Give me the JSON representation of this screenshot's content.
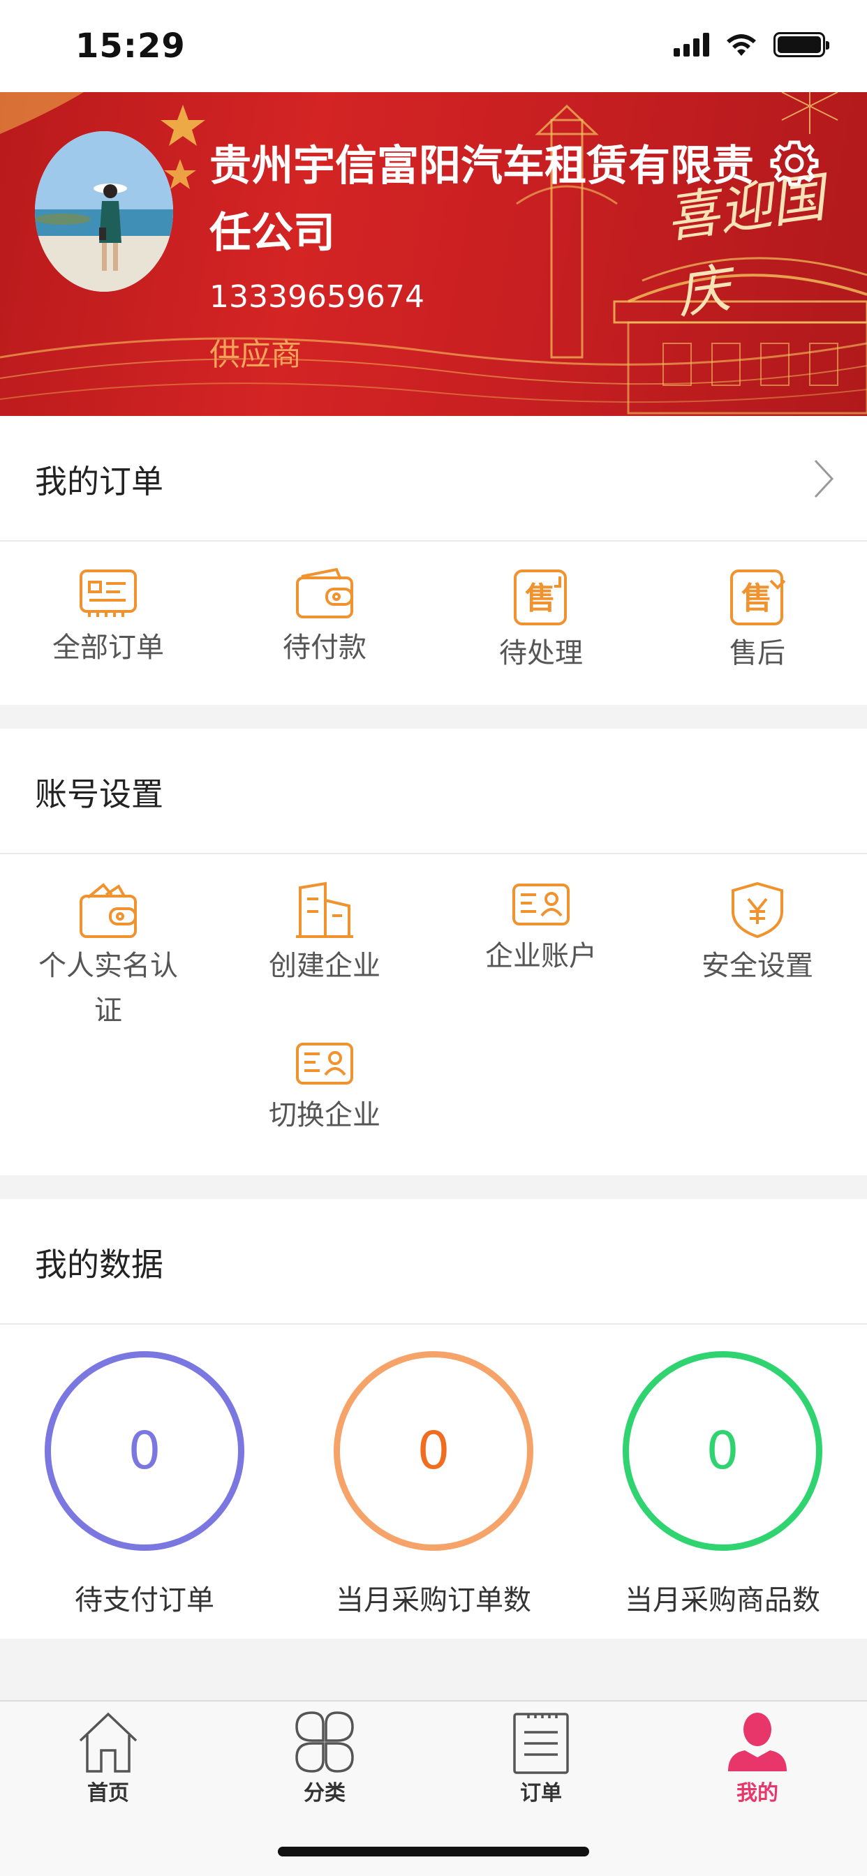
{
  "status_bar": {
    "time": "15:29"
  },
  "profile": {
    "company_name": "贵州宇信富阳汽车租赁有限责任公司",
    "phone": "13339659674",
    "role": "供应商",
    "banner_text": "喜迎国庆"
  },
  "orders": {
    "title": "我的订单",
    "items": [
      {
        "label": "全部订单",
        "icon": "all-orders-icon"
      },
      {
        "label": "待付款",
        "icon": "wallet-icon"
      },
      {
        "label": "待处理",
        "icon": "sale-pending-icon"
      },
      {
        "label": "售后",
        "icon": "after-sale-icon"
      }
    ]
  },
  "account": {
    "title": "账号设置",
    "items": [
      {
        "label": "个人实名认证",
        "icon": "wallet-card-icon"
      },
      {
        "label": "创建企业",
        "icon": "building-icon"
      },
      {
        "label": "企业账户",
        "icon": "id-card-icon"
      },
      {
        "label": "安全设置",
        "icon": "shield-yen-icon"
      },
      {
        "label": "切换企业",
        "icon": "id-card-icon"
      }
    ]
  },
  "data": {
    "title": "我的数据",
    "stats": [
      {
        "value": "0",
        "label": "待支付订单",
        "color": "#7b77e0"
      },
      {
        "value": "0",
        "label": "当月采购订单数",
        "color": "#f6a36a"
      },
      {
        "value": "0",
        "label": "当月采购商品数",
        "color": "#2fd471"
      }
    ]
  },
  "tab_bar": {
    "tabs": [
      {
        "label": "首页",
        "icon": "home-icon"
      },
      {
        "label": "分类",
        "icon": "category-icon"
      },
      {
        "label": "订单",
        "icon": "order-list-icon"
      },
      {
        "label": "我的",
        "icon": "person-icon",
        "active": true
      }
    ]
  },
  "colors": {
    "accent": "#f0922e",
    "banner_red": "#cc2024",
    "active_tab": "#e8356a"
  }
}
